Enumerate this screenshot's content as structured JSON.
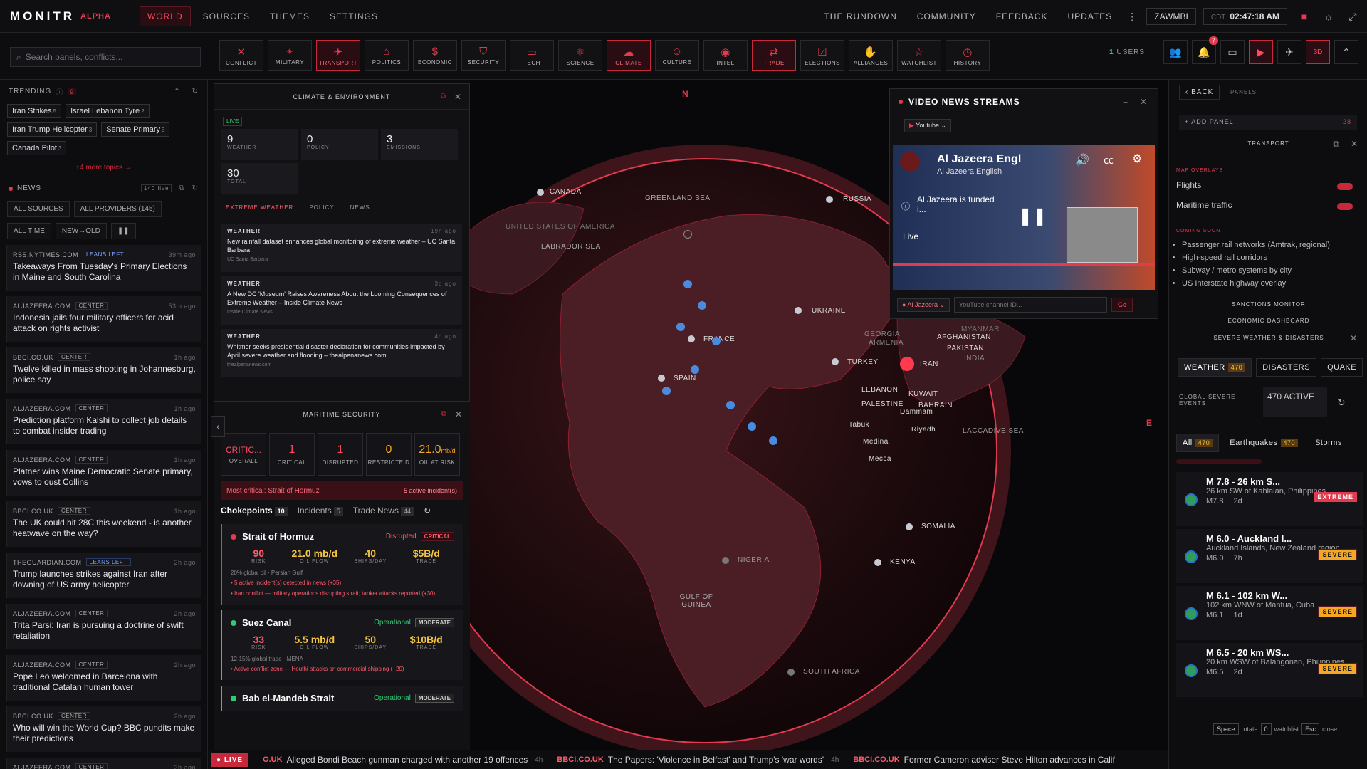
{
  "app": {
    "logo": "MONITR",
    "logo_tag": "ALPHA"
  },
  "nav": {
    "tabs": [
      "WORLD",
      "SOURCES",
      "THEMES",
      "SETTINGS"
    ],
    "right_links": [
      "THE RUNDOWN",
      "COMMUNITY",
      "FEEDBACK",
      "UPDATES"
    ],
    "user": "ZAWMBI",
    "clock_tz": "CDT",
    "clock": "02:47:18 AM"
  },
  "search": {
    "placeholder": "Search panels, conflicts..."
  },
  "categories": [
    {
      "label": "CONFLICT",
      "icon": "crossed-swords-icon",
      "active": false
    },
    {
      "label": "MILITARY",
      "icon": "crosshair-icon",
      "active": false
    },
    {
      "label": "TRANSPORT",
      "icon": "plane-icon",
      "active": true
    },
    {
      "label": "POLITICS",
      "icon": "capitol-icon",
      "active": false
    },
    {
      "label": "ECONOMIC",
      "icon": "dollar-icon",
      "active": false
    },
    {
      "label": "SECURITY",
      "icon": "shield-icon",
      "active": false
    },
    {
      "label": "TECH",
      "icon": "monitor-icon",
      "active": false
    },
    {
      "label": "SCIENCE",
      "icon": "atom-icon",
      "active": false
    },
    {
      "label": "CLIMATE",
      "icon": "cloud-icon",
      "active": true
    },
    {
      "label": "CULTURE",
      "icon": "masks-icon",
      "active": false
    },
    {
      "label": "INTEL",
      "icon": "eye-icon",
      "active": false
    },
    {
      "label": "TRADE",
      "icon": "exchange-icon",
      "active": true
    },
    {
      "label": "ELECTIONS",
      "icon": "ballot-icon",
      "active": false
    },
    {
      "label": "ALLIANCES",
      "icon": "handshake-icon",
      "active": false
    },
    {
      "label": "WATCHLIST",
      "icon": "star-icon",
      "active": false
    },
    {
      "label": "HISTORY",
      "icon": "clock-icon",
      "active": false
    }
  ],
  "toolbar_right": {
    "users_count": "1",
    "users_label": "USERS",
    "notif_count": "7",
    "view_3d": "3D"
  },
  "trending": {
    "title": "TRENDING",
    "count": "9",
    "topics": [
      {
        "label": "Iran Strikes",
        "n": "5"
      },
      {
        "label": "Israel Lebanon Tyre",
        "n": "2"
      },
      {
        "label": "Iran Trump Helicopter",
        "n": "3"
      },
      {
        "label": "Senate Primary",
        "n": "3"
      },
      {
        "label": "Canada Pilot",
        "n": "3"
      }
    ],
    "more": "+4 more topics →"
  },
  "news": {
    "title": "NEWS",
    "live_count": "140 live",
    "filters": [
      "ALL SOURCES",
      "ALL PROVIDERS (145)"
    ],
    "sort": [
      "ALL TIME",
      "NEW→OLD"
    ],
    "items": [
      {
        "src": "RSS.NYTIMES.COM",
        "lean": "LEANS LEFT",
        "age": "39m ago",
        "title": "Takeaways From Tuesday's Primary Elections in Maine and South Carolina"
      },
      {
        "src": "ALJAZEERA.COM",
        "lean": "CENTER",
        "age": "53m ago",
        "title": "Indonesia jails four military officers for acid attack on rights activist"
      },
      {
        "src": "BBCI.CO.UK",
        "lean": "CENTER",
        "age": "1h ago",
        "title": "Twelve killed in mass shooting in Johannesburg, police say"
      },
      {
        "src": "ALJAZEERA.COM",
        "lean": "CENTER",
        "age": "1h ago",
        "title": "Prediction platform Kalshi to collect job details to combat insider trading"
      },
      {
        "src": "ALJAZEERA.COM",
        "lean": "CENTER",
        "age": "1h ago",
        "title": "Platner wins Maine Democratic Senate primary, vows to oust Collins"
      },
      {
        "src": "BBCI.CO.UK",
        "lean": "CENTER",
        "age": "1h ago",
        "title": "The UK could hit 28C this weekend - is another heatwave on the way?"
      },
      {
        "src": "THEGUARDIAN.COM",
        "lean": "LEANS LEFT",
        "age": "2h ago",
        "title": "Trump launches strikes against Iran after downing of US army helicopter"
      },
      {
        "src": "ALJAZEERA.COM",
        "lean": "CENTER",
        "age": "2h ago",
        "title": "Trita Parsi: Iran is pursuing a doctrine of swift retaliation"
      },
      {
        "src": "ALJAZEERA.COM",
        "lean": "CENTER",
        "age": "2h ago",
        "title": "Pope Leo welcomed in Barcelona with traditional Catalan human tower"
      },
      {
        "src": "BBCI.CO.UK",
        "lean": "CENTER",
        "age": "2h ago",
        "title": "Who will win the World Cup? BBC pundits make their predictions"
      },
      {
        "src": "ALJAZEERA.COM",
        "lean": "CENTER",
        "age": "2h ago",
        "title": ""
      }
    ]
  },
  "climate": {
    "title": "CLIMATE & ENVIRONMENT",
    "live": "LIVE",
    "stats": [
      {
        "v": "9",
        "l": "WEATHER"
      },
      {
        "v": "0",
        "l": "POLICY"
      },
      {
        "v": "3",
        "l": "EMISSIONS"
      },
      {
        "v": "30",
        "l": "TOTAL"
      }
    ],
    "tabs": [
      "EXTREME WEATHER",
      "POLICY",
      "NEWS"
    ],
    "items": [
      {
        "cat": "WEATHER",
        "age": "19h ago",
        "title": "New rainfall dataset enhances global monitoring of extreme weather – UC Santa Barbara",
        "src": "UC Santa Barbara"
      },
      {
        "cat": "WEATHER",
        "age": "3d ago",
        "title": "A New DC 'Museum' Raises Awareness About the Looming Consequences of Extreme Weather – Inside Climate News",
        "src": "Inside Climate News"
      },
      {
        "cat": "WEATHER",
        "age": "4d ago",
        "title": "Whitmer seeks presidential disaster declaration for communities impacted by April severe weather and flooding – thealpenanews.com",
        "src": "thealpenanews.com"
      }
    ]
  },
  "maritime": {
    "title": "MARITIME SECURITY",
    "stats": [
      {
        "v": "CRITIC...",
        "l": "OVERALL"
      },
      {
        "v": "1",
        "l": "CRITICAL"
      },
      {
        "v": "1",
        "l": "DISRUPTED"
      },
      {
        "v": "0",
        "l": "RESTRICTE D"
      },
      {
        "v": "21.0",
        "u": "mb/d",
        "l": "OIL AT RISK"
      }
    ],
    "critical": "Most critical: Strait of Hormuz",
    "critical_count": "5 active incident(s)",
    "tabs": [
      {
        "label": "Chokepoints",
        "n": "10"
      },
      {
        "label": "Incidents",
        "n": "5"
      },
      {
        "label": "Trade News",
        "n": "44"
      }
    ],
    "chokepoints": [
      {
        "name": "Strait of Hormuz",
        "status": "Disrupted",
        "sev": "CRITICAL",
        "vals": [
          {
            "v": "90",
            "l": "RISK"
          },
          {
            "v": "21.0 mb/d",
            "l": "OIL FLOW"
          },
          {
            "v": "40",
            "l": "SHIPS/DAY"
          },
          {
            "v": "$5B/d",
            "l": "TRADE"
          }
        ],
        "note": "20% global oil · Persian Gulf",
        "alerts": [
          "• 5 active incident(s) detected in news (+35)",
          "• Iran conflict — military operations disrupting strait; tanker attacks reported (+30)"
        ]
      },
      {
        "name": "Suez Canal",
        "status": "Operational",
        "sev": "MODERATE",
        "vals": [
          {
            "v": "33",
            "l": "RISK"
          },
          {
            "v": "5.5 mb/d",
            "l": "OIL FLOW"
          },
          {
            "v": "50",
            "l": "SHIPS/DAY"
          },
          {
            "v": "$10B/d",
            "l": "TRADE"
          }
        ],
        "note": "12-15% global trade · MENA",
        "alerts": [
          "• Active conflict zone — Houthi attacks on commercial shipping (+20)"
        ]
      },
      {
        "name": "Bab el-Mandeb Strait",
        "status": "Operational",
        "sev": "MODERATE",
        "vals": [],
        "note": "",
        "alerts": []
      }
    ]
  },
  "map": {
    "compass_n": "N",
    "compass_e": "E",
    "labels": [
      "CANADA",
      "GREENLAND SEA",
      "LABRADOR SEA",
      "RUSSIA",
      "UKRAINE",
      "FRANCE",
      "SPAIN",
      "TURKEY",
      "IRAN",
      "AFGHANISTAN",
      "PAKISTAN",
      "INDIA",
      "GEORGIA",
      "ARMENIA",
      "LEBANON",
      "PALESTINE",
      "KUWAIT",
      "BAHRAIN",
      "Riyadh",
      "Tabuk",
      "Medina",
      "Mecca",
      "Dammam",
      "LACCADIVE SEA",
      "SOMALIA",
      "KENYA",
      "NIGERIA",
      "GULF OF GUINEA",
      "SOUTH AFRICA",
      "MYANMAR",
      "UNITED STATES OF AMERICA"
    ]
  },
  "video": {
    "title": "VIDEO NEWS STREAMS",
    "platform": "Youtube",
    "channel_title": "Al Jazeera Engl",
    "channel_sub": "Al Jazeera English",
    "funded": "Al Jazeera is funded i...",
    "live": "Live",
    "channel": "Al Jazeera",
    "input_placeholder": "YouTube channel ID...",
    "go": "Go"
  },
  "right": {
    "back": "BACK",
    "panels": "PANELS",
    "add_panel": "+ ADD PANEL",
    "add_count": "28",
    "transport_title": "TRANSPORT",
    "map_overlays": "MAP OVERLAYS",
    "flights": "Flights",
    "maritime": "Maritime traffic",
    "coming_soon": "COMING SOON",
    "coming": [
      "Passenger rail networks (Amtrak, regional)",
      "High-speed rail corridors",
      "Subway / metro systems by city",
      "US Interstate highway overlay"
    ],
    "sanctions": "SANCTIONS MONITOR",
    "econ": "ECONOMIC DASHBOARD",
    "severe": "SEVERE WEATHER & DISASTERS",
    "wtabs": [
      {
        "label": "WEATHER",
        "n": "470"
      },
      {
        "label": "DISASTERS",
        "n": ""
      },
      {
        "label": "QUAKE",
        "n": ""
      }
    ],
    "global_label": "GLOBAL SEVERE EVENTS",
    "global_value": "470 ACTIVE",
    "ftabs": [
      {
        "label": "All",
        "n": "470"
      },
      {
        "label": "Earthquakes",
        "n": "470"
      },
      {
        "label": "Storms",
        "n": ""
      }
    ],
    "quakes": [
      {
        "t": "M 7.8 - 26 km S...",
        "s": "26 km SW of Kablalan, Philippines",
        "m": "M7.8",
        "age": "2d",
        "sev": "EXTREME"
      },
      {
        "t": "M 6.0 - Auckland I...",
        "s": "Auckland Islands, New Zealand region",
        "m": "M6.0",
        "age": "7h",
        "sev": "SEVERE"
      },
      {
        "t": "M 6.1 - 102 km W...",
        "s": "102 km WNW of Mantua, Cuba",
        "m": "M6.1",
        "age": "1d",
        "sev": "SEVERE"
      },
      {
        "t": "M 6.5 - 20 km WS...",
        "s": "20 km WSW of Balangonan, Philippines",
        "m": "M6.5",
        "age": "2d",
        "sev": "SEVERE"
      }
    ],
    "keys": [
      {
        "k": "Space",
        "d": "rotate"
      },
      {
        "k": "0",
        "d": "watchlist"
      },
      {
        "k": "Esc",
        "d": "close"
      }
    ]
  },
  "ticker": {
    "live": "LIVE",
    "items": [
      {
        "src": "O.UK",
        "t": "Alleged Bondi Beach gunman charged with another 19 offences",
        "age": "4h"
      },
      {
        "src": "BBCI.CO.UK",
        "t": "The Papers: 'Violence in Belfast' and Trump's 'war words'",
        "age": "4h"
      },
      {
        "src": "BBCI.CO.UK",
        "t": "Former Cameron adviser Steve Hilton advances in Calif",
        "age": ""
      }
    ]
  }
}
